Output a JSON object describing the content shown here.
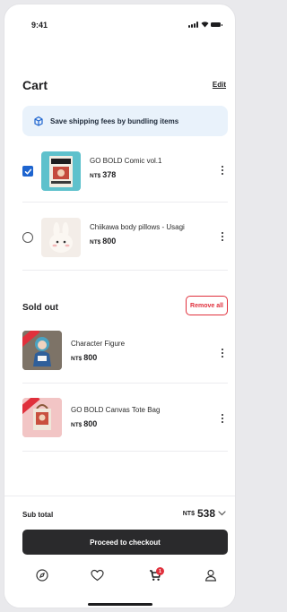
{
  "status_bar": {
    "time": "9:41"
  },
  "header": {
    "title": "Cart",
    "edit_label": "Edit"
  },
  "banner": {
    "text": "Save shipping fees by bundling items",
    "icon": "package-icon",
    "accent": "#1d64cf"
  },
  "cart_items": [
    {
      "name": "GO BOLD Comic vol.1",
      "currency": "NT$",
      "price": "378",
      "selected": true
    },
    {
      "name": "Chiikawa body pillows - Usagi",
      "currency": "NT$",
      "price": "800",
      "selected": false
    }
  ],
  "sold_out": {
    "title": "Sold out",
    "remove_all_label": "Remove all",
    "items": [
      {
        "name": "Character Figure",
        "currency": "NT$",
        "price": "800"
      },
      {
        "name": "GO BOLD Canvas Tote Bag",
        "currency": "NT$",
        "price": "800"
      }
    ]
  },
  "footer": {
    "subtotal_label": "Sub total",
    "subtotal_currency": "NT$",
    "subtotal_value": "538",
    "checkout_label": "Proceed to checkout",
    "cart_badge_count": "1",
    "tabs": [
      "compass-icon",
      "heart-icon",
      "cart-icon",
      "profile-icon"
    ]
  },
  "colors": {
    "primary": "#1d64cf",
    "danger": "#e0303c",
    "button_dark": "#2a2a2c"
  }
}
